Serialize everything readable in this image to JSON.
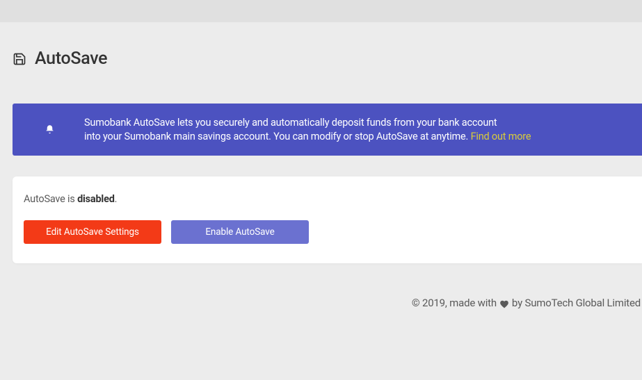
{
  "page": {
    "title": "AutoSave"
  },
  "banner": {
    "text_part1": "Sumobank AutoSave lets you securely and automatically deposit funds from your bank account",
    "text_part2": "into your Sumobank main savings account. You can modify or stop AutoSave at anytime. ",
    "link_text": "Find out more"
  },
  "status": {
    "prefix": "AutoSave is ",
    "state": "disabled",
    "suffix": "."
  },
  "buttons": {
    "edit": "Edit AutoSave Settings",
    "enable": "Enable AutoSave"
  },
  "footer": {
    "part1": "© 2019, made with ",
    "part2": " by SumoTech Global Limited"
  }
}
